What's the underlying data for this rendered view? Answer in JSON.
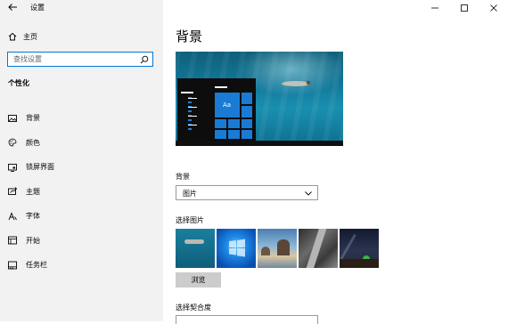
{
  "window": {
    "title": "设置",
    "controls": [
      "minimize",
      "maximize",
      "close"
    ]
  },
  "sidebar": {
    "home_label": "主页",
    "search_placeholder": "查找设置",
    "section_title": "个性化",
    "items": [
      {
        "label": "背景",
        "icon": "image-icon",
        "selected": true
      },
      {
        "label": "颜色",
        "icon": "palette-icon",
        "selected": false
      },
      {
        "label": "锁屏界面",
        "icon": "lock-screen-icon",
        "selected": false
      },
      {
        "label": "主题",
        "icon": "theme-icon",
        "selected": false
      },
      {
        "label": "字体",
        "icon": "font-icon",
        "selected": false
      },
      {
        "label": "开始",
        "icon": "start-icon",
        "selected": false
      },
      {
        "label": "任务栏",
        "icon": "taskbar-icon",
        "selected": false
      }
    ]
  },
  "main": {
    "page_title": "背景",
    "preview_tile_label": "Aa",
    "background_label": "背景",
    "background_value": "图片",
    "choose_picture_label": "选择图片",
    "browse_label": "浏览",
    "fit_label": "选择契合度"
  },
  "colors": {
    "accent": "#0078d7",
    "sidebar_bg": "#f2f2f2",
    "button_bg": "#cccccc"
  }
}
